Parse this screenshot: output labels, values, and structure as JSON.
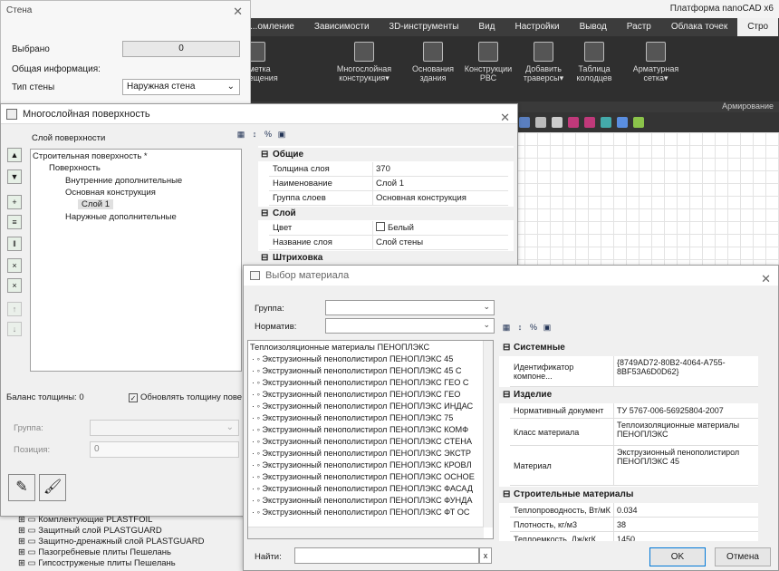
{
  "app": {
    "title": "Платформа nanoCAD x6",
    "ribbon_tabs": [
      "...омление",
      "Зависимости",
      "3D-инструменты",
      "Вид",
      "Настройки",
      "Вывод",
      "Растр",
      "Облака точек",
      "Стро"
    ],
    "ribbon_buttons": [
      {
        "label": "...метка\n...ещения"
      },
      {
        "label": "Многослойная\nконструкция▾"
      },
      {
        "label": "Основания\nздания"
      },
      {
        "label": "Конструкции\nРВС"
      },
      {
        "label": "Добавить\nтраверсы▾"
      },
      {
        "label": "Таблица\nколодцев"
      },
      {
        "label": "Арматурная\nсетка▾"
      }
    ],
    "ribbon_group_label": "Армирование"
  },
  "wall_panel": {
    "title": "Стена",
    "selected_label": "Выбрано",
    "selected_value": "0",
    "general_info_label": "Общая информация:",
    "wall_type_label": "Тип стены",
    "wall_type_value": "Наружная стена"
  },
  "layered_surface": {
    "title": "Многослойная поверхность",
    "surface_layer_label": "Слой поверхности",
    "tree": [
      {
        "label": "Строительная поверхность *"
      },
      {
        "label": "Поверхность"
      },
      {
        "label": "Внутренние дополнительные"
      },
      {
        "label": "Основная конструкция"
      },
      {
        "label": "Слой 1"
      },
      {
        "label": "Наружные дополнительные"
      }
    ],
    "props": {
      "section_general": "Общие",
      "thickness_label": "Толщина слоя",
      "thickness_value": "370",
      "name_label": "Наименование",
      "name_value": "Слой 1",
      "group_label": "Группа слоев",
      "group_value": "Основная конструкция",
      "section_layer": "Слой",
      "color_label": "Цвет",
      "color_value": "Белый",
      "layer_name_label": "Название слоя",
      "layer_name_value": "Слой стены",
      "section_hatch": "Штриховка"
    },
    "balance_label": "Баланс толщины: 0",
    "update_thickness_label": "Обновлять толщину пове",
    "update_thickness_checked": true,
    "group_label": "Группа:",
    "position_label": "Позиция:",
    "position_value": "0"
  },
  "bottom_tree": [
    "Комплектующие PLASTFOIL",
    "Защитный слой PLASTGUARD",
    "Защитно-дренажный слой PLASTGUARD",
    "Пазогребневые плиты Пешелань",
    "Гипсоструженые плиты Пешелань"
  ],
  "material_dialog": {
    "title": "Выбор материала",
    "group_label": "Группа:",
    "group_value": "",
    "norm_label": "Норматив:",
    "norm_value": "",
    "list_header": "Теплоизоляционные материалы ПЕНОПЛЭКС",
    "materials": [
      "Экструзионный пенополистирол ПЕНОПЛЭКС 45",
      "Экструзионный пенополистирол ПЕНОПЛЭКС 45 С",
      "Экструзионный пенополистирол ПЕНОПЛЭКС ГЕО С",
      "Экструзионный пенополистирол ПЕНОПЛЭКС ГЕО",
      "Экструзионный пенополистирол ПЕНОПЛЭКС ИНДАС",
      "Экструзионный пенополистирол ПЕНОПЛЭКС 75",
      "Экструзионный пенополистирол ПЕНОПЛЭКС КОМФ",
      "Экструзионный пенополистирол ПЕНОПЛЭКС СТЕНА",
      "Экструзионный пенополистирол ПЕНОПЛЭКС ЭКСТР",
      "Экструзионный пенополистирол ПЕНОПЛЭКС КРОВЛ",
      "Экструзионный пенополистирол ПЕНОПЛЭКС ОСНОЕ",
      "Экструзионный пенополистирол ПЕНОПЛЭКС ФАСАД",
      "Экструзионный пенополистирол ПЕНОПЛЭКС ФУНДА",
      "Экструзионный пенополистирол ПЕНОПЛЭКС ФТ ОС"
    ],
    "props": {
      "section_system": "Системные",
      "component_id_label": "Идентификатор компоне...",
      "component_id_value": "{8749AD72-80B2-4064-A755-8BF53A6D0D62}",
      "section_product": "Изделие",
      "norm_doc_label": "Нормативный документ",
      "norm_doc_value": "ТУ 5767-006-56925804-2007",
      "class_label": "Класс материала",
      "class_value": "Теплоизоляционные материалы ПЕНОПЛЭКС",
      "material_label": "Материал",
      "material_value": "Экструзионный пенополистирол ПЕНОПЛЭКС 45",
      "section_building": "Строительные материалы",
      "conductivity_label": "Теплопроводность, Вт/мК",
      "conductivity_value": "0.034",
      "density_label": "Плотность, кг/м3",
      "density_value": "38",
      "heat_capacity_label": "Теплоемкость, Дж/кгК",
      "heat_capacity_value": "1450"
    },
    "find_label": "Найти:",
    "find_value": "",
    "clear_label": "x",
    "ok_label": "OK",
    "cancel_label": "Отмена"
  }
}
